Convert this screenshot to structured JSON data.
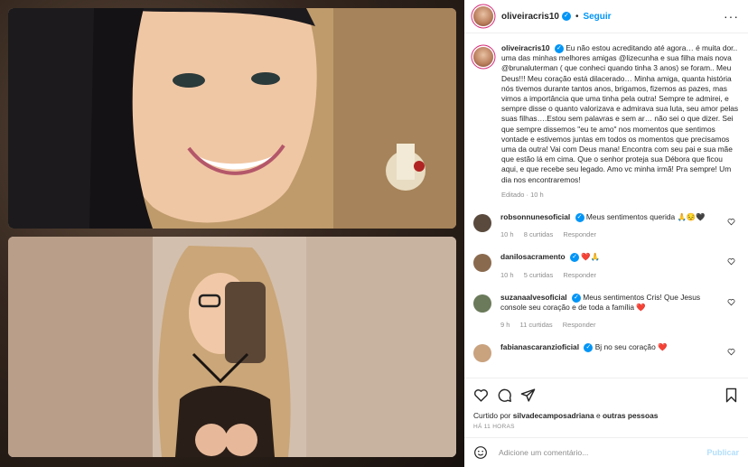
{
  "post": {
    "username": "oliveiracris10",
    "follow_label": "Seguir",
    "caption_text": "Eu não estou acreditando até agora… é muita dor.. uma das minhas melhores amigas @lizecunha e sua filha mais nova @brunaluterman ( que conheci quando tinha 3 anos) se foram.. Meu Deus!!! Meu coração está dilacerado… Minha amiga, quanta história nós tivemos durante tantos anos, brigamos, fizemos as pazes, mas vimos a importância que uma tinha pela outra! Sempre te admirei, e sempre disse o quanto valorizava e admirava sua luta, seu amor pelas suas filhas….Estou sem palavras e sem ar… não sei o que dizer. Sei que sempre dissemos \"eu te amo\" nos momentos que sentimos vontade e estivemos juntas em todos os momentos que precisamos uma da outra! Vai com Deus mana! Encontra com seu pai e sua mãe que estão lá em cima. Que o senhor proteja sua Débora que ficou aqui, e que recebe seu legado. Amo vc minha irmã! Pra sempre! Um dia nos encontraremos!",
    "caption_meta": "Editado · 10 h"
  },
  "comments": [
    {
      "username": "robsonnunesoficial",
      "text": "Meus sentimentos querida 🙏😔🖤",
      "time": "10 h",
      "likes": "8 curtidas",
      "reply": "Responder",
      "color": "#5a4a3e"
    },
    {
      "username": "danilosacramento",
      "text": "❤️🙏",
      "time": "10 h",
      "likes": "5 curtidas",
      "reply": "Responder",
      "color": "#8a6a4e"
    },
    {
      "username": "suzanaalvesoficial",
      "text": "Meus sentimentos Cris! Que Jesus console seu coração e de toda a família ❤️",
      "time": "9 h",
      "likes": "11 curtidas",
      "reply": "Responder",
      "color": "#6a7a5a"
    },
    {
      "username": "fabianascaranzioficial",
      "text": "Bj no seu coração ❤️",
      "color": "#c9a27e"
    }
  ],
  "footer": {
    "liked_prefix": "Curtido por",
    "liked_user": "silvadecamposadriana",
    "liked_suffix": "e",
    "liked_others": "outras pessoas",
    "time_ago": "HÁ 11 HORAS",
    "comment_placeholder": "Adicione um comentário...",
    "publish_label": "Publicar"
  },
  "icons": [
    "more-icon",
    "heart-icon",
    "comment-icon",
    "share-icon",
    "save-icon",
    "emoji-icon",
    "verified-icon"
  ],
  "colors": {
    "accent": "#0095f6",
    "muted": "#8e8e8e",
    "like_red": "#ed4956"
  }
}
